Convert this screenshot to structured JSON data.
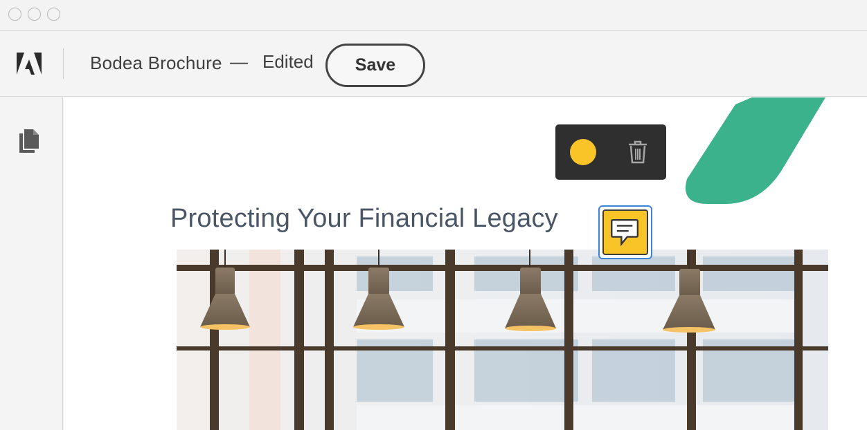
{
  "window": {
    "traffic_lights": [
      "close",
      "minimize",
      "zoom"
    ]
  },
  "toolbar": {
    "app_logo_icon": "adobe-logo",
    "document_title": "Bodea Brochure",
    "separator": "—",
    "status": "Edited",
    "save_label": "Save"
  },
  "sidebar": {
    "items": [
      {
        "icon": "pages-icon"
      }
    ]
  },
  "document": {
    "heading": "Protecting Your Financial Legacy",
    "accent_color": "#3bb18c",
    "image_description_icon": "office-lamps-photo"
  },
  "annotation_popover": {
    "color_swatch": "#f8c427",
    "delete_icon": "trash-icon"
  },
  "comment_marker": {
    "icon": "comment-icon",
    "color": "#f8c427",
    "selected_outline": "#3b84d9"
  }
}
